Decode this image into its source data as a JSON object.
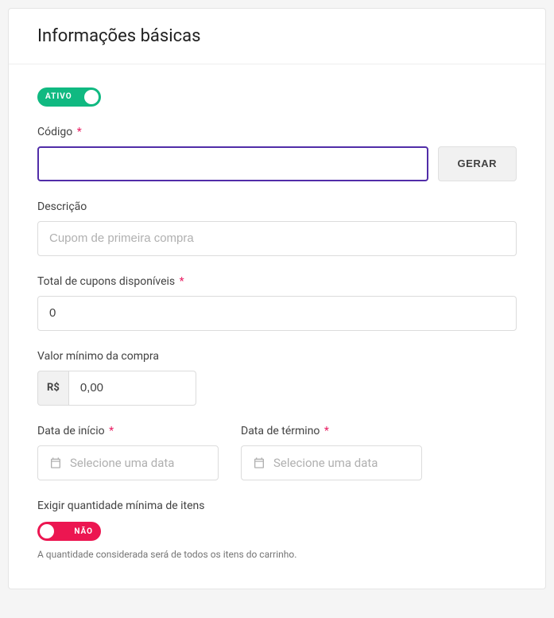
{
  "header": {
    "title": "Informações básicas"
  },
  "status_toggle": {
    "label": "ATIVO",
    "on": true
  },
  "code": {
    "label": "Código",
    "required": true,
    "value": "",
    "generate_button": "GERAR"
  },
  "description": {
    "label": "Descrição",
    "placeholder": "Cupom de primeira compra",
    "value": ""
  },
  "total_coupons": {
    "label": "Total de cupons disponíveis",
    "required": true,
    "value": "0"
  },
  "min_purchase": {
    "label": "Valor mínimo da compra",
    "prefix": "R$",
    "value": "0,00"
  },
  "start_date": {
    "label": "Data de início",
    "required": true,
    "placeholder": "Selecione uma data"
  },
  "end_date": {
    "label": "Data de término",
    "required": true,
    "placeholder": "Selecione uma data"
  },
  "min_items": {
    "label": "Exigir quantidade mínima de itens",
    "toggle_label": "NÃO",
    "on": false,
    "help": "A quantidade considerada será de todos os itens do carrinho."
  },
  "required_mark": "*"
}
